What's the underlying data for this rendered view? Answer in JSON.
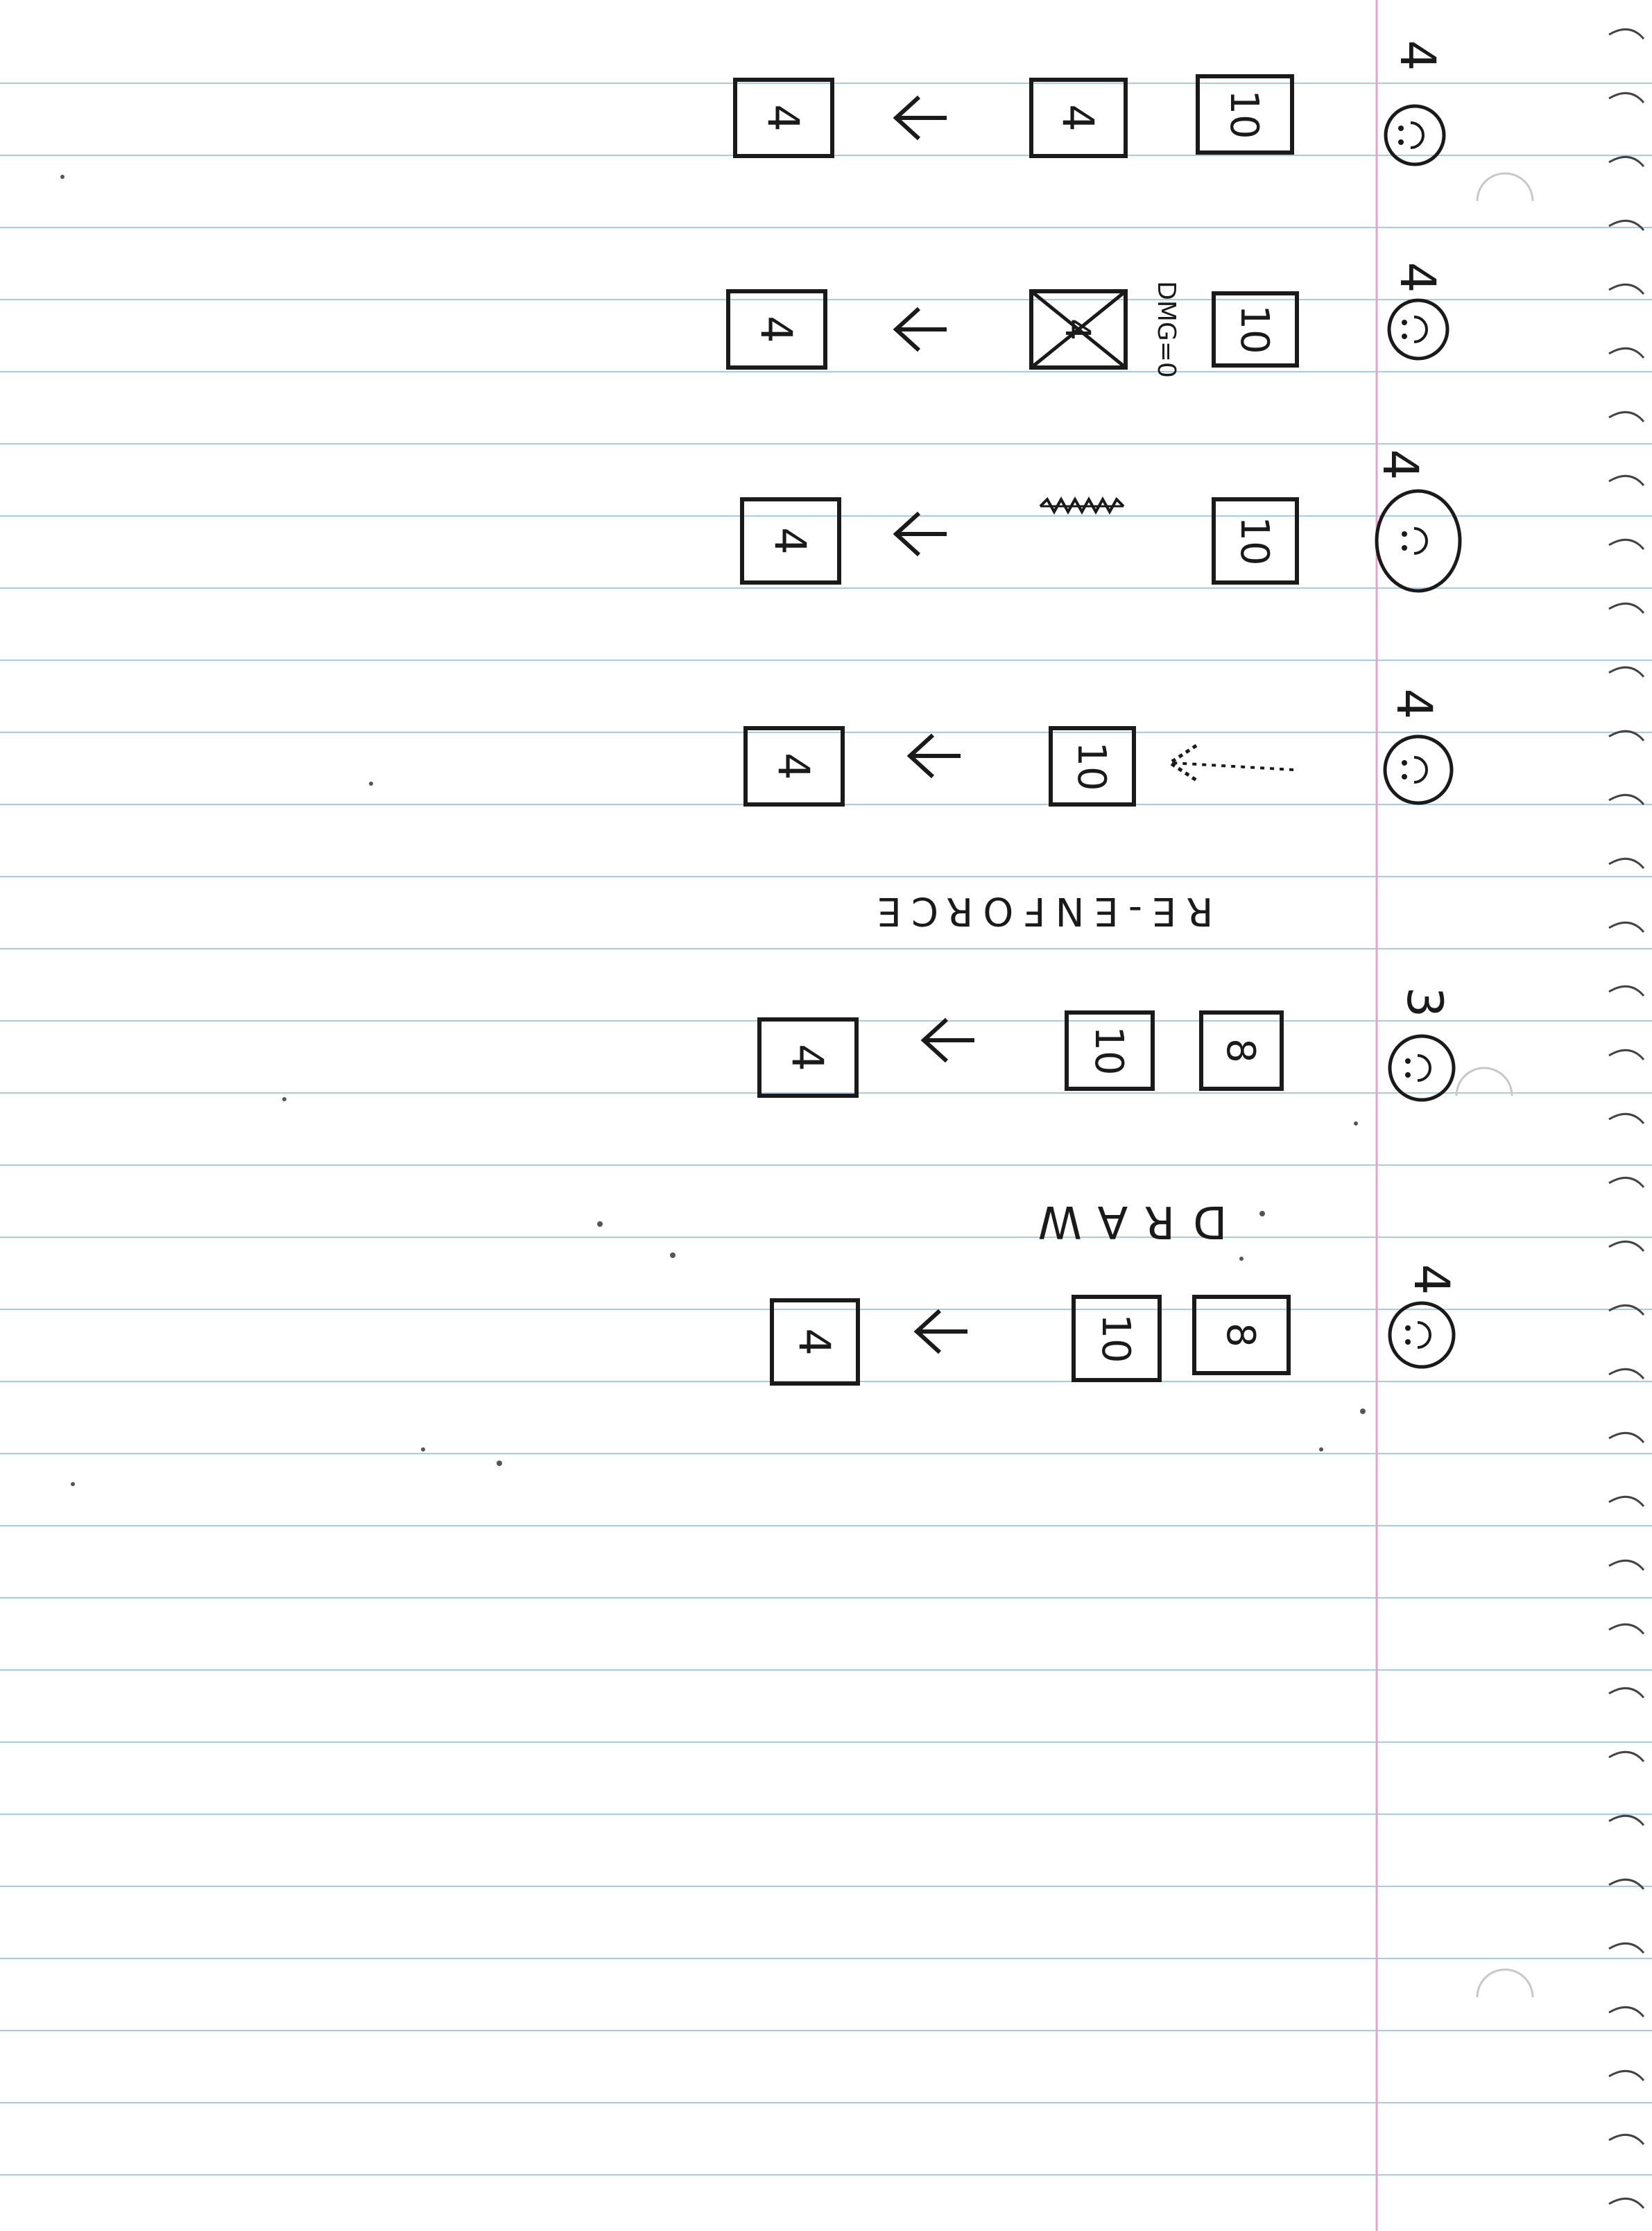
{
  "paper": {
    "line_color": "#a9cbe8",
    "margin_color": "#e6a3c8",
    "ink_color": "#1a1a1a",
    "paper_color": "#ffffff"
  },
  "rows": [
    {
      "player": {
        "health": "4",
        "face": "smiley-icon"
      },
      "middle_cards": [
        "10"
      ],
      "target": "4",
      "result": "4",
      "annotation": "",
      "target_crossed": false,
      "target_removed": false,
      "incoming_arrow": false
    },
    {
      "player": {
        "health": "4",
        "face": "smiley-icon"
      },
      "middle_cards": [
        "10"
      ],
      "target": "4",
      "result": "4",
      "annotation": "DMG=0",
      "target_crossed": true,
      "target_removed": false,
      "incoming_arrow": false
    },
    {
      "player": {
        "health": "4",
        "face": "smiley-icon"
      },
      "middle_cards": [
        "10"
      ],
      "target": "",
      "result": "4",
      "annotation": "",
      "target_crossed": false,
      "target_removed": true,
      "incoming_arrow": false
    },
    {
      "player": {
        "health": "4",
        "face": "smiley-icon"
      },
      "middle_cards": [],
      "target": "10",
      "result": "4",
      "annotation": "",
      "target_crossed": false,
      "target_removed": false,
      "incoming_arrow": true
    },
    {
      "player": {
        "health": "3",
        "face": "smiley-icon"
      },
      "middle_cards": [
        "8"
      ],
      "target": "10",
      "result": "4",
      "annotation": "",
      "target_crossed": false,
      "target_removed": false,
      "incoming_arrow": false
    },
    {
      "player": {
        "health": "4",
        "face": "smiley-icon"
      },
      "middle_cards": [
        "8"
      ],
      "target": "10",
      "result": "4",
      "annotation": "",
      "target_crossed": false,
      "target_removed": false,
      "incoming_arrow": false
    }
  ],
  "step_labels": {
    "after_row_4": "RE-ENFORCE",
    "after_row_5": "DRAW"
  }
}
